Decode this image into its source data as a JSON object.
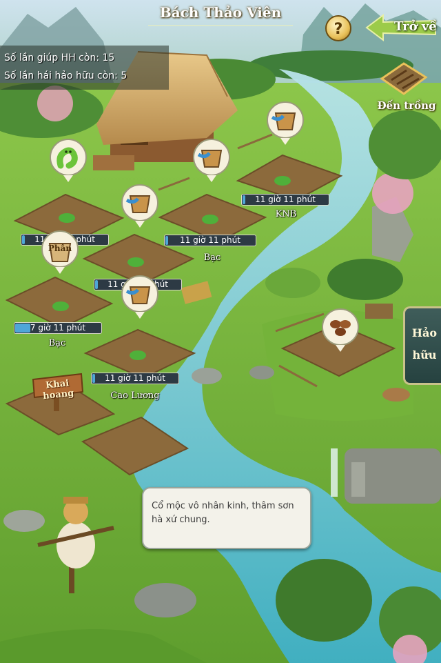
{
  "header": {
    "title": "Bách Thảo Viên",
    "help_label": "?",
    "back_label": "Trở về"
  },
  "info": {
    "help_count": "Số lần giúp HH còn: 15",
    "pick_count": "Số lần hái hảo hữu còn: 5"
  },
  "go_field": {
    "label": "Đến trồng",
    "icon": "farm-plot-icon"
  },
  "friend_button": {
    "line1": "Hảo",
    "line2": "hữu"
  },
  "plots": [
    {
      "timer": "11 giờ 11 phút",
      "label": "KNB",
      "progress": 0.03,
      "bubble": "water-bucket-icon"
    },
    {
      "timer": "11 giờ 11 phút",
      "label": "Bạc",
      "progress": 0.03,
      "bubble": "water-bucket-icon"
    },
    {
      "timer": "11 giờ 11 phút",
      "label": "",
      "progress": 0.03,
      "bubble": "water-bucket-icon"
    },
    {
      "timer": "11 giờ 11 phút",
      "label": "",
      "progress": 0.03,
      "bubble": "worm-icon"
    },
    {
      "timer": "7 giờ 11 phút",
      "label": "Bạc",
      "progress": 0.18,
      "bubble": "fertilizer-icon"
    },
    {
      "timer": "11 giờ 11 phút",
      "label": "Cao Lương",
      "progress": 0.03,
      "bubble": "none"
    }
  ],
  "fertilizer_label": "Phân",
  "clear_sign": "Khai hoang",
  "seed_bubble": "seeds-icon",
  "dialog_text": "Cổ mộc vô nhân kinh, thâm sơn hà xứ chung.",
  "colors": {
    "grass": "#78b83a",
    "river": "#5ec6d9",
    "soil": "#8a6a3c",
    "accent": "#e9c15a"
  }
}
